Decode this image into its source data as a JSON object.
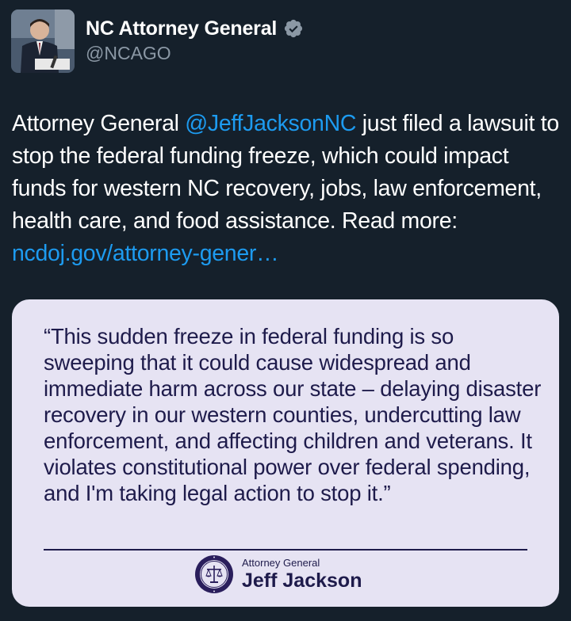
{
  "author": {
    "display_name": "NC Attorney General",
    "handle": "@NCAGO",
    "verified_icon": "verified-badge-icon",
    "avatar_icon": "profile-photo"
  },
  "tweet": {
    "text_before_mention": "Attorney General ",
    "mention": "@JeffJacksonNC",
    "text_after_mention": " just filed a lawsuit to stop the federal funding freeze, which could impact funds for western NC recovery, jobs, law enforcement, health care, and food assistance. Read more: ",
    "link": "ncdoj.gov/attorney-gener…"
  },
  "quote_card": {
    "quote": "“This sudden freeze in federal funding is so sweeping that it could cause widespread and immediate harm across our state – delaying disaster recovery in our western counties, undercutting law enforcement, and affecting children and veterans. It violates constitutional power over federal spending, and I'm taking legal action to stop it.”",
    "signature_title": "Attorney General",
    "signature_name": "Jeff Jackson",
    "seal_icon": "department-of-justice-seal-icon",
    "background_color": "#e6e3f3",
    "text_color": "#1e1b4b"
  },
  "colors": {
    "background": "#15202b",
    "link": "#1d9bf0",
    "secondary_text": "#8b98a5"
  }
}
